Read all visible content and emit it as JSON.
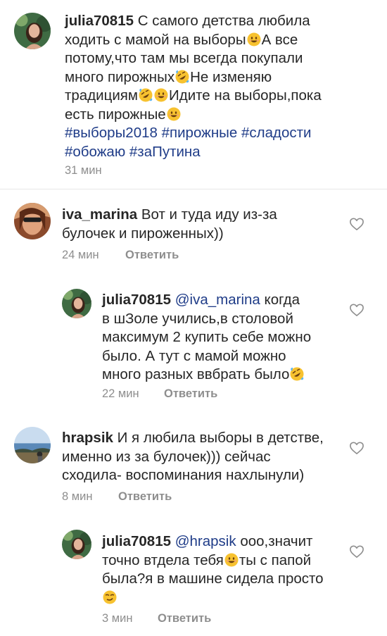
{
  "caption": {
    "username": "julia70815",
    "lines": [
      "С самого детства любила",
      "ходить с мамой на выборы",
      "А все",
      "потому,что там мы всегда покупали",
      "много пирожных",
      "Не изменяю",
      "традициям",
      "Идите на выборы,пока",
      "есть пирожные",
      "#выборы2018 #пирожные #сладости",
      "#обожаю #заПутина"
    ],
    "time": "31 мин"
  },
  "comments": [
    {
      "username": "iva_marina",
      "lines": [
        "Вот и туда иду из-за",
        "булочек и пироженных))"
      ],
      "time": "24 мин",
      "reply_label": "Ответить"
    },
    {
      "username": "julia70815",
      "mention": "@iva_marina",
      "lines": [
        "когда",
        "в шЗоле учились,в столовой",
        "максимум 2 купить себе можно",
        "было. А тут с мамой можно",
        "много разных ввбрать было"
      ],
      "time": "22 мин",
      "reply_label": "Ответить"
    },
    {
      "username": "hrapsik",
      "lines": [
        "И я любила выборы в детстве,",
        "именно из за булочек))) сейчас",
        "сходила- воспоминания нахлынули)"
      ],
      "time": "8 мин",
      "reply_label": "Ответить"
    },
    {
      "username": "julia70815",
      "mention": "@hrapsik",
      "lines": [
        "ооо,значит",
        "точно втдела тебя",
        "ты с папой",
        "была?я в машине сидела просто"
      ],
      "time": "3 мин",
      "reply_label": "Ответить"
    }
  ],
  "colors": {
    "hashtag": "#1f3c88",
    "meta": "#8e8e8e",
    "text": "#262626"
  },
  "icons": [
    "heart-outline-icon",
    "smiling-face-emoji",
    "rolling-laughing-emoji",
    "smirk-face-emoji"
  ]
}
